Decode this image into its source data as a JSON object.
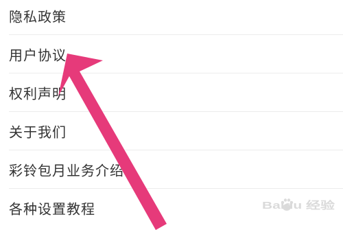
{
  "menu": {
    "items": [
      {
        "label": "隐私政策"
      },
      {
        "label": "用户协议"
      },
      {
        "label": "权利声明"
      },
      {
        "label": "关于我们"
      },
      {
        "label": "彩铃包月业务介绍"
      },
      {
        "label": "各种设置教程"
      }
    ]
  },
  "annotation": {
    "arrow_color": "#e63a7a",
    "arrow_target": "用户协议"
  },
  "watermark": {
    "text": "Baidu 经验",
    "logo": "baidu-paw-icon"
  },
  "colors": {
    "text": "#333333",
    "divider": "#ececec",
    "background": "#ffffff"
  }
}
